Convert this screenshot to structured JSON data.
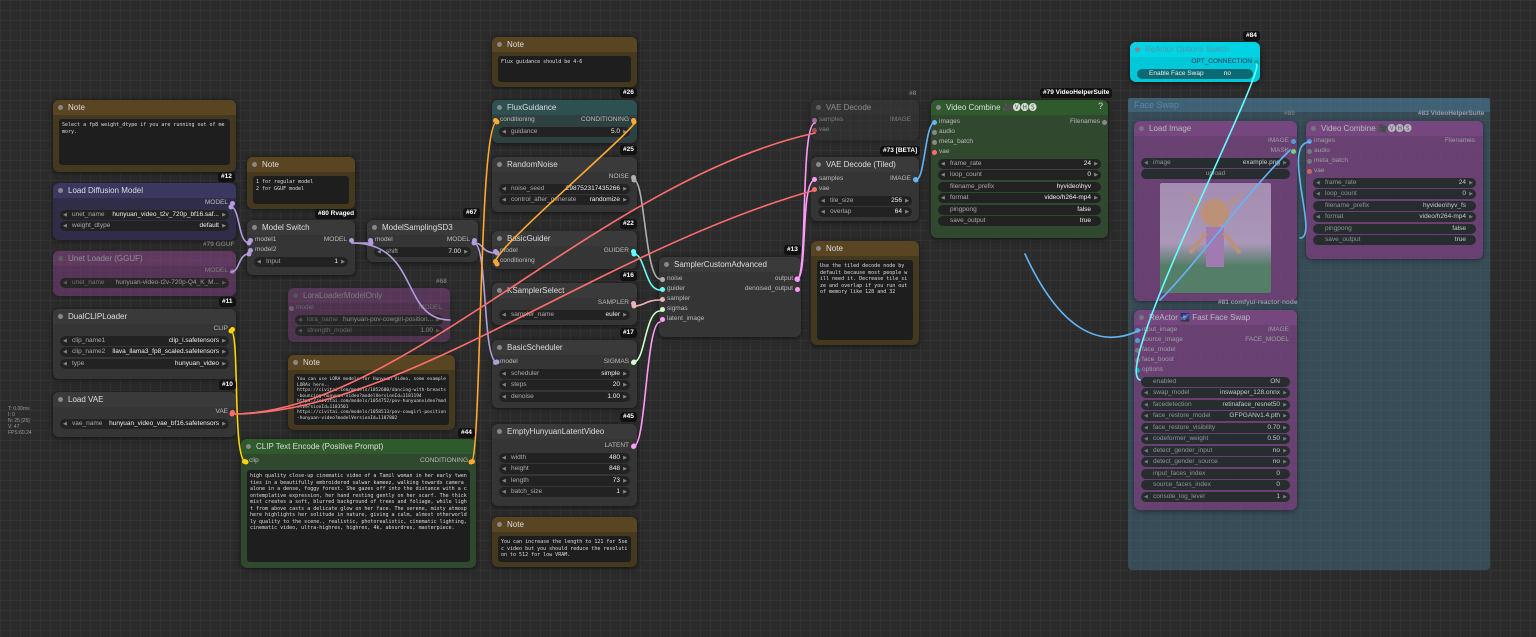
{
  "colors": {
    "clip": "#ffd500",
    "model": "#b39ddb",
    "vae": "#ff6e6e",
    "conditioning": "#ffa931",
    "latent": "#ff9cf9",
    "image": "#64b5f6",
    "sigmas": "#cdffcd",
    "noise": "#b0b0b0",
    "guider": "#66ffff",
    "sampler": "#ecb4b4",
    "int": "#29699c"
  },
  "nodes": {
    "note12": {
      "title": "Note",
      "text": "Select a fp8 weight_dtype if you are running out of memory.",
      "badge": "#12"
    },
    "note80": {
      "title": "Note",
      "text": "1 for regular model\n2 for GGUF model",
      "badge": "#80 Rvaged"
    },
    "note26": {
      "title": "Note",
      "text": "Flux guidance should be 4-6",
      "badge": "#26"
    },
    "note_lora": {
      "title": "Note",
      "text": "You can use LORA models for Hunyuan Video, some example LORAs here..\nhttps://civitai.com/models/1052680/dancing-with-breasts-bouncing-hunyuan-video?modelVersionId=1181194\nhttps://civitai.com/models/1054752/pov-hunyuanvideo?modelVersionId=1183501\nhttps://civitai.com/models/1058513/pov-cowgirl-position-hunyuan-video?modelVersionId=1187802",
      "badge": "#44"
    },
    "note_tiled": {
      "title": "Note",
      "text": "Use the tiled decode node by default because most people will need it. Decrease tile_size and overlap if you run out of memory like 128 and 32",
      "badge": ""
    },
    "note_len": {
      "title": "Note",
      "text": "You can increase the length to 121 for 5sec video but you should reduce the resolution to 512 for low VRAM.",
      "badge": ""
    },
    "load_diffusion": {
      "title": "Load Diffusion Model",
      "out": "MODEL",
      "unet_name_label": "unet_name",
      "unet_name": "hunyuan_video_t2v_720p_bf16.saf...",
      "weight_dtype_label": "weight_dtype",
      "weight_dtype": "default",
      "badge": "#79 GGUF"
    },
    "unet_gguf": {
      "title": "Unet Loader (GGUF)",
      "out": "MODEL",
      "unet_name_label": "unet_name",
      "unet_name": "hunyuan-video-t2v-720p-Q4_K_M...",
      "badge": "#11"
    },
    "dualclip": {
      "title": "DualCLIPLoader",
      "out": "CLIP",
      "clip_name1_label": "clip_name1",
      "clip_name1": "clip_l.safetensors",
      "clip_name2_label": "clip_name2",
      "clip_name2": "llava_llama3_fp8_scaled.safetensors",
      "type_label": "type",
      "type": "hunyuan_video",
      "badge": "#10"
    },
    "loadvae": {
      "title": "Load VAE",
      "out": "VAE",
      "vae_name_label": "vae_name",
      "vae_name": "hunyuan_video_vae_bf16.safetensors"
    },
    "modelswitch": {
      "title": "Model Switch",
      "in1": "model1",
      "in2": "model2",
      "out": "MODEL",
      "input_label": "Input",
      "input": "1"
    },
    "modelsampling": {
      "title": "ModelSamplingSD3",
      "in": "model",
      "out": "MODEL",
      "shift_label": "shift",
      "shift": "7.00",
      "badge": "#67"
    },
    "lora": {
      "title": "LoraLoaderModelOnly",
      "in": "model",
      "out": "MODEL",
      "lora_name_label": "lora_name",
      "lora_name": "hunyuan-pov-cowgirl-position...",
      "strength_label": "strength_model",
      "strength": "1.00",
      "badge": "#68"
    },
    "cliptext": {
      "title": "CLIP Text Encode (Positive Prompt)",
      "in": "clip",
      "out": "CONDITIONING",
      "text": "high quality close-up cinematic video of a Tamil woman in her early twenties in a beautifully embroidered salwar kameez, walking towards camera alone in a dense, foggy forest. She gazes off into the distance with a contemplative expression, her hand resting gently on her scarf. The thick mist creates a soft, blurred background of trees and foliage, while light from above casts a delicate glow on her face. The serene, misty atmosphere highlights her solitude in nature, giving a calm, almost otherworldly quality to the scene., realistic, photorealistic, cinematic lighting, cinematic video, ultra-highres, highres, 4k, absurdres, masterpiece."
    },
    "flux": {
      "title": "FluxGuidance",
      "in": "conditioning",
      "out": "CONDITIONING",
      "guidance_label": "guidance",
      "guidance": "5.0",
      "badge": "#25"
    },
    "randomnoise": {
      "title": "RandomNoise",
      "out": "NOISE",
      "seed_label": "noise_seed",
      "seed": "298752317435266",
      "cag_label": "control_after_generate",
      "cag": "randomize",
      "badge": "#22"
    },
    "basicguider": {
      "title": "BasicGuider",
      "in1": "model",
      "in2": "conditioning",
      "out": "GUIDER",
      "badge": "#16"
    },
    "ksampler": {
      "title": "KSamplerSelect",
      "out": "SAMPLER",
      "sampler_label": "sampler_name",
      "sampler": "euler",
      "badge": "#17"
    },
    "scheduler": {
      "title": "BasicScheduler",
      "in": "model",
      "out": "SIGMAS",
      "sch_label": "scheduler",
      "sch": "simple",
      "steps_label": "steps",
      "steps": "20",
      "denoise_label": "denoise",
      "denoise": "1.00",
      "badge": "#45"
    },
    "emptylatent": {
      "title": "EmptyHunyuanLatentVideo",
      "out": "LATENT",
      "width_label": "width",
      "width": "480",
      "height_label": "height",
      "height": "848",
      "length_label": "length",
      "length": "73",
      "batch_label": "batch_size",
      "batch": "1"
    },
    "sca": {
      "title": "SamplerCustomAdvanced",
      "in1": "noise",
      "in2": "guider",
      "in3": "sampler",
      "in4": "sigmas",
      "in5": "latent_image",
      "out1": "output",
      "out2": "denoised_output",
      "badge": "#13"
    },
    "vaedecode": {
      "title": "VAE Decode",
      "in1": "samples",
      "in2": "vae",
      "out": "IMAGE",
      "badge": "#8"
    },
    "vaetiled": {
      "title": "VAE Decode (Tiled)",
      "in1": "samples",
      "in2": "vae",
      "out": "IMAGE",
      "tile_label": "tile_size",
      "tile": "256",
      "overlap_label": "overlap",
      "overlap": "64",
      "badge": "#73 [BETA]"
    },
    "videocombine": {
      "title": "Video Combine 🎥🅥🅗🅢",
      "in1": "images",
      "in2": "audio",
      "in3": "meta_batch",
      "in4": "vae",
      "out": "Filenames",
      "fr_label": "frame_rate",
      "fr": "24",
      "lc_label": "loop_count",
      "lc": "0",
      "fp_label": "filename_prefix",
      "fp": "hyvideo\\hyv",
      "fmt_label": "format",
      "fmt": "video/h264-mp4",
      "pp_label": "pingpong",
      "pp": "false",
      "so_label": "save_output",
      "so": "true",
      "badge": "#79 VideoHelperSuite",
      "help": "?"
    },
    "reactor_opt": {
      "title": "ReActor Options Switch",
      "out": "OPT_CONNECTION",
      "enable_label": "Enable Face Swap",
      "enable": "no",
      "badge": "#84"
    },
    "group": {
      "title": "Face Swap"
    },
    "loadimage": {
      "title": "Load Image",
      "out1": "IMAGE",
      "out2": "MASK",
      "img_label": "image",
      "img": "example.png",
      "upload": "upload",
      "badge": "#80"
    },
    "reactor": {
      "title": "ReActor 🌌 Fast Face Swap",
      "in1": "input_image",
      "in2": "source_image",
      "in3": "face_model",
      "in4": "face_boost",
      "in5": "options",
      "out1": "IMAGE",
      "out2": "FACE_MODEL",
      "enabled_label": "enabled",
      "enabled": "ON",
      "swap_label": "swap_model",
      "swap": "inswapper_128.onnx",
      "fd_label": "facedetection",
      "fd": "retinaface_resnet50",
      "fr_label": "face_restore_model",
      "fr": "GFPGANv1.4.pth",
      "vis_label": "face_restore_visibility",
      "vis": "0.70",
      "cw_label": "codeformer_weight",
      "cw": "0.50",
      "dg_label": "detect_gender_input",
      "dg": "no",
      "dgs_label": "detect_gender_source",
      "dgs": "no",
      "ifi_label": "input_faces_index",
      "ifi": "0",
      "sfi_label": "source_faces_index",
      "sfi": "0",
      "cl_label": "console_log_level",
      "cl": "1",
      "badge": "#81 comfyui-reactor-node"
    },
    "vc2": {
      "title": "Video Combine 🎥🅥🅗🅢",
      "in1": "images",
      "in2": "audio",
      "in3": "meta_batch",
      "in4": "vae",
      "out": "Filenames",
      "fr_label": "frame_rate",
      "fr": "24",
      "lc_label": "loop_count",
      "lc": "0",
      "fp_label": "filename_prefix",
      "fp": "hyvideo\\hyv_fs",
      "fmt_label": "format",
      "fmt": "video/h264-mp4",
      "pp_label": "pingpong",
      "pp": "false",
      "so_label": "save_output",
      "so": "true",
      "badge": "#83 VideoHelperSuite"
    }
  },
  "sidebar_text": "T: 0.00ms\nI: 0\nN: 25 [25]\nV: 47\nFPS:60.24"
}
